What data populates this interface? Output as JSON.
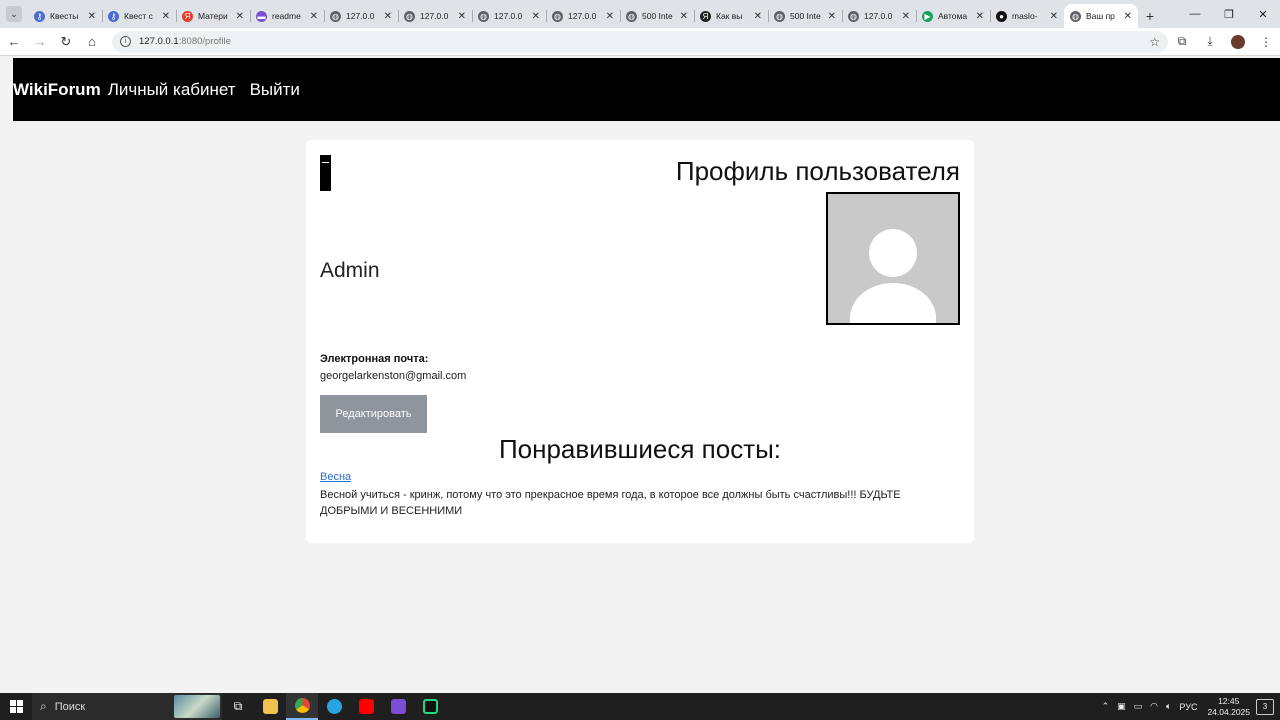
{
  "browser": {
    "tabs": [
      {
        "title": "Квесты",
        "icon_color": "#4a6cd4",
        "icon": "key-icon"
      },
      {
        "title": "Квест с",
        "icon_color": "#4a6cd4",
        "icon": "key-icon"
      },
      {
        "title": "Матери",
        "icon_color": "#e63b2e",
        "icon": "yandex-icon"
      },
      {
        "title": "readme",
        "icon_color": "#7b4fd1",
        "icon": "readme-icon"
      },
      {
        "title": "127.0.0",
        "icon_color": "#5f6368",
        "icon": "globe-icon"
      },
      {
        "title": "127.0.0",
        "icon_color": "#5f6368",
        "icon": "globe-icon"
      },
      {
        "title": "127.0.0",
        "icon_color": "#5f6368",
        "icon": "globe-icon"
      },
      {
        "title": "127.0.0",
        "icon_color": "#5f6368",
        "icon": "globe-icon"
      },
      {
        "title": "500 Inte",
        "icon_color": "#5f6368",
        "icon": "globe-icon"
      },
      {
        "title": "Как вы",
        "icon_color": "#222222",
        "icon": "yandex-icon"
      },
      {
        "title": "500 Inte",
        "icon_color": "#5f6368",
        "icon": "globe-icon"
      },
      {
        "title": "127.0.0",
        "icon_color": "#5f6368",
        "icon": "globe-icon"
      },
      {
        "title": "Автома",
        "icon_color": "#1aa260",
        "icon": "play-icon"
      },
      {
        "title": "maslo-",
        "icon_color": "#111111",
        "icon": "github-icon"
      },
      {
        "title": "Ваш пр",
        "icon_color": "#5f6368",
        "icon": "globe-icon",
        "active": true
      }
    ],
    "url_host": "127.0.0.1",
    "url_path": ":8080/profile"
  },
  "site": {
    "brand": "WikiForum",
    "nav": {
      "cabinet": "Личный кабинет",
      "logout": "Выйти"
    }
  },
  "profile": {
    "title": "Профиль пользователя",
    "username": "Admin",
    "email_label": "Электронная почта:",
    "email": "georgelarkenston@gmail.com",
    "edit_label": "Редактировать",
    "liked_title": "Понравившиеся посты:",
    "posts": [
      {
        "title": "Весна",
        "text": "Весной учиться - кринж, потому что это прекрасное время года, в которое все должны быть счастливы!!! БУДЬТЕ ДОБРЫМИ И ВЕСЕННИМИ"
      }
    ]
  },
  "taskbar": {
    "search_placeholder": "Поиск",
    "lang": "РУС",
    "time": "12:45",
    "date": "24.04.2025",
    "notifications": "3"
  }
}
